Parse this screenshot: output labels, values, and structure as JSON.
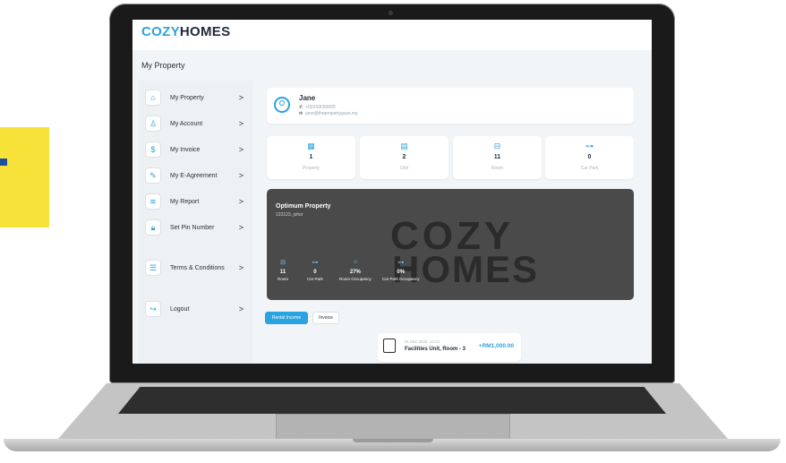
{
  "app": {
    "logo_part1": "COZY",
    "logo_part2": "HOMES",
    "page_heading": "My Property"
  },
  "colors": {
    "accent": "#2aa3e0",
    "dark": "#1e2b3a",
    "banner": "#4a4a4a",
    "yellow": "#f7e23a"
  },
  "sidebar": {
    "items": [
      {
        "label": "My Property",
        "icon": "home-icon"
      },
      {
        "label": "My Account",
        "icon": "user-icon"
      },
      {
        "label": "My Invoice",
        "icon": "invoice-icon"
      },
      {
        "label": "My E-Agreement",
        "icon": "agreement-icon"
      },
      {
        "label": "My Report",
        "icon": "report-icon"
      },
      {
        "label": "Set Pin Number",
        "icon": "lock-icon"
      },
      {
        "label": "Terms & Conditions",
        "icon": "document-icon"
      },
      {
        "label": "Logout",
        "icon": "logout-icon"
      }
    ],
    "chevron": ">"
  },
  "profile": {
    "name": "Jane",
    "phone": "+60169090000",
    "email": "jane@thepropertyguys.my"
  },
  "stats": [
    {
      "value": "1",
      "label": "Property",
      "icon": "building-icon"
    },
    {
      "value": "2",
      "label": "Unit",
      "icon": "unit-icon"
    },
    {
      "value": "11",
      "label": "Room",
      "icon": "bed-icon"
    },
    {
      "value": "0",
      "label": "Car Park",
      "icon": "car-icon"
    }
  ],
  "property": {
    "name": "Optimum Property",
    "address": "123123, johor",
    "watermark_line1": "COZY",
    "watermark_line2": "HOMES",
    "stats": [
      {
        "value": "11",
        "label": "Room",
        "icon": "bed-icon"
      },
      {
        "value": "0",
        "label": "Car Park",
        "icon": "car-icon"
      },
      {
        "value": "27%",
        "label": "Room Occupancy",
        "icon": "house-icon"
      },
      {
        "value": "0%",
        "label": "Car Park Occupancy",
        "icon": "car-icon"
      }
    ]
  },
  "tabs": {
    "active": "Rental Income",
    "inactive": "Invoice"
  },
  "transaction": {
    "date": "01 Mar 2025, 10:14",
    "title": "Facilities Unit, Room - 3",
    "amount": "+RM1,000.00"
  }
}
